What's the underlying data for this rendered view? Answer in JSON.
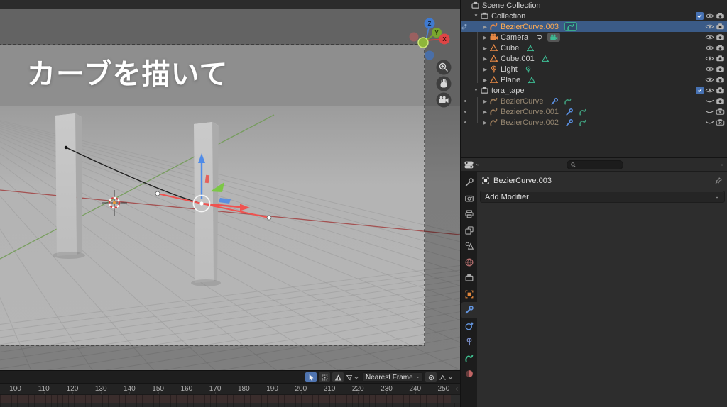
{
  "viewport": {
    "caption": "カーブを描いて",
    "gizmo": {
      "x_label": "X",
      "y_label": "Y",
      "z_label": "Z"
    },
    "nav_buttons": [
      "zoom",
      "pan",
      "camera-view"
    ]
  },
  "timeline": {
    "playback_mode": "Nearest Frame",
    "frame_labels": [
      "100",
      "110",
      "120",
      "130",
      "140",
      "150",
      "160",
      "170",
      "180",
      "190",
      "200",
      "210",
      "220",
      "230",
      "240",
      "250"
    ],
    "band_color": "#3a2d2c"
  },
  "outliner": {
    "rows": [
      {
        "label": "Scene Collection",
        "icon": "collection",
        "icon_class": "c-gray",
        "indent": 0,
        "arrow": "",
        "toggles": []
      },
      {
        "label": "Collection",
        "icon": "collection",
        "icon_class": "c-gray",
        "indent": 1,
        "arrow": "down",
        "toggles": [
          "checkbox",
          "eye",
          "camera"
        ]
      },
      {
        "label": "BezierCurve.003",
        "icon": "curve",
        "icon_class": "c-orange",
        "indent": 2,
        "arrow": "right",
        "selected": true,
        "marker": "sync",
        "badges": [
          "curve:boxed"
        ],
        "toggles": [
          "eye",
          "camera"
        ]
      },
      {
        "label": "Camera",
        "icon": "camera-obj",
        "icon_class": "c-orange",
        "indent": 2,
        "arrow": "right",
        "badges": [
          "constraint:plain",
          "camera-obj:boxedbg"
        ],
        "toggles": [
          "eye",
          "camera"
        ]
      },
      {
        "label": "Cube",
        "icon": "mesh",
        "icon_class": "c-orange",
        "indent": 2,
        "arrow": "right",
        "badges": [
          "mesh:plain"
        ],
        "toggles": [
          "eye",
          "camera"
        ]
      },
      {
        "label": "Cube.001",
        "icon": "mesh",
        "icon_class": "c-orange",
        "indent": 2,
        "arrow": "right",
        "badges": [
          "mesh:plain"
        ],
        "toggles": [
          "eye",
          "camera"
        ]
      },
      {
        "label": "Light",
        "icon": "light",
        "icon_class": "c-orange",
        "indent": 2,
        "arrow": "right",
        "badges": [
          "light:plain"
        ],
        "toggles": [
          "eye",
          "camera"
        ]
      },
      {
        "label": "Plane",
        "icon": "mesh",
        "icon_class": "c-orange",
        "indent": 2,
        "arrow": "right",
        "badges": [
          "mesh:plain"
        ],
        "toggles": [
          "eye",
          "camera"
        ]
      },
      {
        "label": "tora_tape",
        "icon": "collection",
        "icon_class": "c-gray",
        "indent": 1,
        "arrow": "down",
        "toggles": [
          "checkbox",
          "eye",
          "camera"
        ]
      },
      {
        "label": "BezierCurve",
        "icon": "curve",
        "icon_class": "c-mutorange",
        "indent": 2,
        "arrow": "right",
        "muted": true,
        "marker": "dot",
        "badges": [
          "wrench:plain",
          "curve-mut:plain"
        ],
        "toggles": [
          "eye-closed",
          "camera"
        ]
      },
      {
        "label": "BezierCurve.001",
        "icon": "curve",
        "icon_class": "c-mutorange",
        "indent": 2,
        "arrow": "right",
        "muted": true,
        "marker": "dot",
        "badges": [
          "wrench:plain",
          "curve-mut:plain"
        ],
        "toggles": [
          "eye-closed",
          "camera-x"
        ]
      },
      {
        "label": "BezierCurve.002",
        "icon": "curve",
        "icon_class": "c-mutorange",
        "indent": 2,
        "arrow": "right",
        "muted": true,
        "marker": "dot",
        "badges": [
          "wrench:plain",
          "curve-mut:plain"
        ],
        "toggles": [
          "eye-closed",
          "camera-x"
        ]
      }
    ]
  },
  "properties": {
    "active_object": "BezierCurve.003",
    "add_modifier_label": "Add Modifier",
    "search_placeholder": "",
    "tabs": [
      {
        "name": "tool",
        "color": "#a8a8a8"
      },
      {
        "name": "render",
        "color": "#a8a8a8"
      },
      {
        "name": "output",
        "color": "#a8a8a8"
      },
      {
        "name": "view-layer",
        "color": "#a8a8a8"
      },
      {
        "name": "scene",
        "color": "#a8a8a8"
      },
      {
        "name": "world",
        "color": "#b87070"
      },
      {
        "name": "collection",
        "color": "#a8a8a8"
      },
      {
        "name": "object",
        "color": "#e0873c"
      },
      {
        "name": "modifiers",
        "color": "#6496e0",
        "active": true
      },
      {
        "name": "physics",
        "color": "#6496e0"
      },
      {
        "name": "constraints",
        "color": "#7b8fc9"
      },
      {
        "name": "object-data",
        "color": "#3fbf8f"
      },
      {
        "name": "material",
        "color": "#c06464"
      }
    ]
  },
  "colors": {
    "selection_blue": "#3b5b87",
    "active_text_orange": "#ffab52",
    "object_icon_orange": "#e68845",
    "data_icon_teal": "#3dbc94",
    "modifier_blue": "#5a8fe0",
    "checkbox_blue": "#4772b3"
  }
}
